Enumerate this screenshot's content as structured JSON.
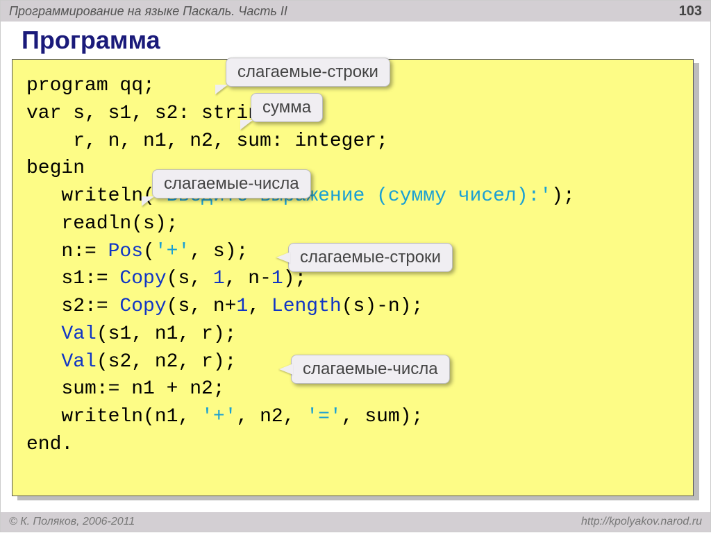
{
  "header": {
    "title": "Программирование на языке Паскаль. Часть II",
    "page": "103"
  },
  "slide_title": "Программа",
  "code": {
    "l1": "program qq;",
    "l2": "var s, s1, s2: string;",
    "l3": "    r, n, n1, n2, sum: integer;",
    "l4": "begin",
    "l5a": "   writeln(",
    "l5b": "'Введите выражение (сумму чисел):'",
    "l5c": ");",
    "l6": "   readln(s);",
    "l7a": "   n:= ",
    "l7b": "Pos",
    "l7c": "(",
    "l7d": "'+'",
    "l7e": ", s);",
    "l8a": "   s1:= ",
    "l8b": "Copy",
    "l8c": "(s, ",
    "l8d": "1",
    "l8e": ", n-",
    "l8f": "1",
    "l8g": ");",
    "l9a": "   s2:= ",
    "l9b": "Copy",
    "l9c": "(s, n+",
    "l9d": "1",
    "l9e": ", ",
    "l9f": "Length",
    "l9g": "(s)-n);",
    "l10a": "   ",
    "l10b": "Val",
    "l10c": "(s1, n1, r);",
    "l11a": "   ",
    "l11b": "Val",
    "l11c": "(s2, n2, r);",
    "l12": "   sum:= n1 + n2;",
    "l13a": "   writeln(n1, ",
    "l13b": "'+'",
    "l13c": ", n2, ",
    "l13d": "'='",
    "l13e": ", sum);",
    "l14": "end."
  },
  "callouts": {
    "c1": "слагаемые-строки",
    "c2": "сумма",
    "c3": "слагаемые-числа",
    "c4": "слагаемые-строки",
    "c5": "слагаемые-числа"
  },
  "footer": {
    "copyright": "© К. Поляков, 2006-2011",
    "url": "http://kpolyakov.narod.ru"
  }
}
